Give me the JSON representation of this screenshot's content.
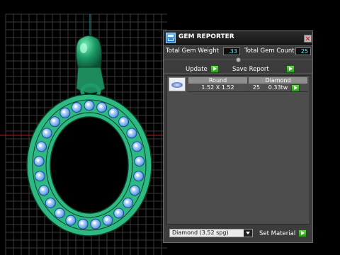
{
  "panel": {
    "title": "GEM REPORTER",
    "total_weight_label": "Total Gem Weight",
    "total_weight_value": ".33",
    "total_count_label": "Total Gem Count",
    "total_count_value": "25",
    "update_label": "Update",
    "save_report_label": "Save Report",
    "slider_position": 0.5
  },
  "table": {
    "headers": [
      "Round",
      "Diamond"
    ],
    "rows": [
      {
        "size": "1.52 X 1.52",
        "count": "25",
        "weight": "0.33tw"
      }
    ]
  },
  "footer": {
    "material_value": "Diamond   (3.52 spg)",
    "set_material_label": "Set Material"
  },
  "viewport": {
    "metal_color": "#2bb87e",
    "gem_color": "#6aaaf0",
    "grid_color": "#3a3a3a",
    "x_axis_color": "#c02020",
    "y_axis_color": "#20a0a0"
  }
}
